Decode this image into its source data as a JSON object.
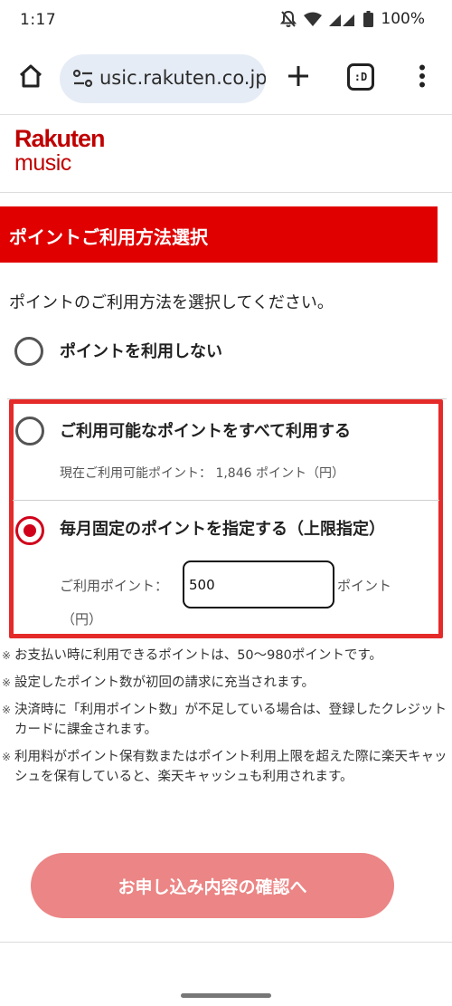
{
  "status_bar": {
    "time": "1:17",
    "battery": "100%"
  },
  "browser": {
    "url": "usic.rakuten.co.jp",
    "tab_count": ":D"
  },
  "logo": {
    "line1": "Rakuten",
    "line2": "music",
    "color": "#bf0000"
  },
  "page": {
    "title": "ポイントご利用方法選択",
    "instruction": "ポイントのご利用方法を選択してください。",
    "options": [
      {
        "label": "ポイントを利用しない",
        "selected": false
      },
      {
        "label": "ご利用可能なポイントをすべて利用する",
        "selected": false,
        "detail": "現在ご利用可能ポイント： 1,846 ポイント（円）"
      },
      {
        "label": "毎月固定のポイントを指定する（上限指定）",
        "selected": true
      }
    ],
    "points_input": {
      "label": "ご利用ポイント：",
      "value": "500",
      "unit_line1": "ポイント",
      "unit_line2": "（円）"
    },
    "notes": [
      {
        "mark": "※",
        "text": "お支払い時に利用できるポイントは、50〜980ポイントです。"
      },
      {
        "mark": "※",
        "text": "設定したポイント数が初回の請求に充当されます。"
      },
      {
        "mark": "※",
        "text": "決済時に「利用ポイント数」が不足している場合は、登録したクレジットカードに課金されます。"
      },
      {
        "mark": "※",
        "text": "利用料がポイント保有数またはポイント利用上限を超えた際に楽天キャッシュを保有していると、楽天キャッシュも利用されます。"
      }
    ],
    "confirm_button": "お申し込み内容の確認へ"
  },
  "colors": {
    "brand_red": "#e00000",
    "highlight_border": "#e52a2a",
    "button_bg": "#ec8585",
    "url_bar_bg": "#e6ecf5"
  },
  "icons": [
    "mute-icon",
    "wifi-icon",
    "signal-icon",
    "battery-icon",
    "home-icon",
    "tune-icon",
    "plus-icon",
    "more-vert-icon"
  ]
}
